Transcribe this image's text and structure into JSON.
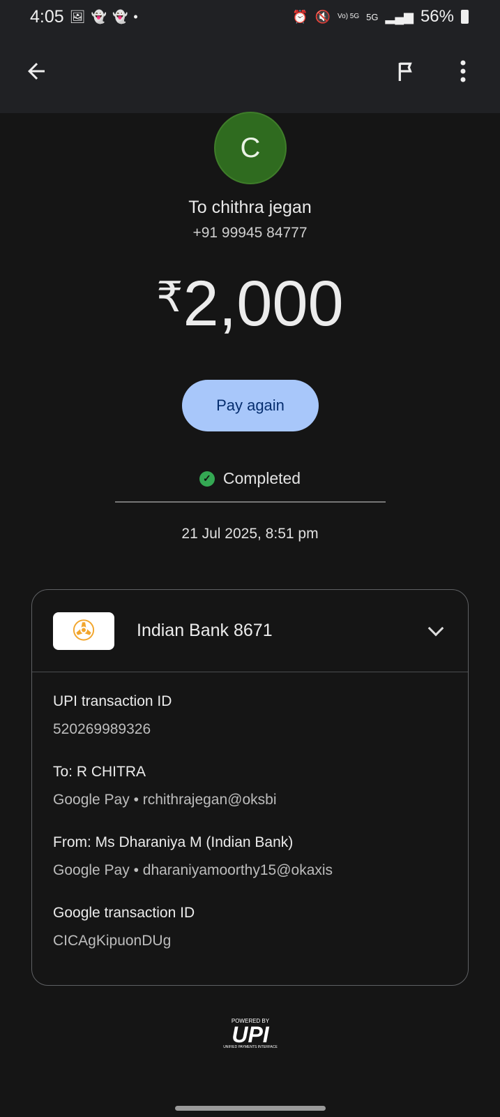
{
  "status": {
    "time": "4:05",
    "battery": "56%",
    "network": "5G",
    "volte": "Vo) 5G"
  },
  "header": {
    "icons": [
      "back-arrow-icon",
      "flag-icon",
      "more-vert-icon"
    ]
  },
  "payee": {
    "initial": "C",
    "to": "To chithra jegan",
    "phone": "+91 99945 84777"
  },
  "amount": {
    "currency": "₹",
    "value": "2,000"
  },
  "pay_again": "Pay again",
  "status_text": "Completed",
  "date": "21 Jul 2025, 8:51 pm",
  "card": {
    "bank": "Indian Bank 8671",
    "details": [
      {
        "label": "UPI transaction ID",
        "value": "520269989326"
      },
      {
        "label": "To: R CHITRA",
        "value": "Google Pay • rchithrajegan@oksbi"
      },
      {
        "label": "From: Ms Dharaniya M (Indian Bank)",
        "value": "Google Pay • dharaniyamoorthy15@okaxis"
      },
      {
        "label": "Google transaction ID",
        "value": "CICAgKipuonDUg"
      }
    ]
  },
  "footer": {
    "powered": "POWERED BY",
    "upi": "UPI",
    "sub": "UNIFIED PAYMENTS INTERFACE"
  },
  "colors": {
    "accent": "#a8c7fa",
    "avatar": "#2f6b1f",
    "success": "#34a853"
  }
}
